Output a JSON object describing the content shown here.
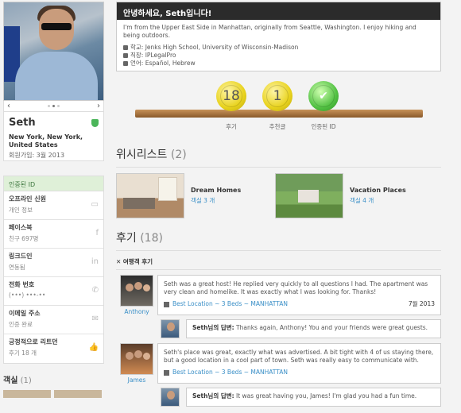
{
  "profile": {
    "name": "Seth",
    "location": "New York, New York, United States",
    "member_since": "회원가입: 3월 2013",
    "prev": "‹",
    "next": "›"
  },
  "verifications": {
    "header": "인증된 ID",
    "items": [
      {
        "title": "오프라인 신원",
        "sub": "개인 정보",
        "icon": "id-card-icon",
        "glyph": "▭"
      },
      {
        "title": "페이스북",
        "sub": "친구 697명",
        "icon": "facebook-icon",
        "glyph": "f"
      },
      {
        "title": "링크드인",
        "sub": "연동됨",
        "icon": "linkedin-icon",
        "glyph": "in"
      },
      {
        "title": "전화 번호",
        "sub": "(•••) •••-••",
        "icon": "phone-icon",
        "glyph": "✆"
      },
      {
        "title": "이메일 주소",
        "sub": "인증 완료",
        "icon": "mail-icon",
        "glyph": "✉"
      },
      {
        "title": "긍정적으로 리트던",
        "sub": "후기 18 개",
        "icon": "thumbs-up-icon",
        "glyph": "👍"
      }
    ]
  },
  "left_wishlist": {
    "title": "객실",
    "count": "(1)"
  },
  "greeting": {
    "title": "안녕하세요, Seth입니다!",
    "bio": "I'm from the Upper East Side in Manhattan, originally from Seattle, Washington. I enjoy hiking and being outdoors.",
    "school": "학교: Jenks High School, University of Wisconsin-Madison",
    "work": "직장: IPLegalPro",
    "languages": "언어: Español, Hebrew"
  },
  "badges": [
    {
      "value": "18",
      "label": "후기"
    },
    {
      "value": "1",
      "label": "추천글"
    },
    {
      "value": "✔",
      "label": "인증된 ID"
    }
  ],
  "wishlists": {
    "title": "위시리스트",
    "count": "(2)",
    "items": [
      {
        "name": "Dream Homes",
        "count": "객실 3 개"
      },
      {
        "name": "Vacation Places",
        "count": "객실 4 개"
      }
    ]
  },
  "reviews": {
    "title": "후기",
    "count": "(18)",
    "tab": "✕ 여행객 후기",
    "items": [
      {
        "author": "Anthony",
        "text": "Seth was a great host! He replied very quickly to all questions I had. The apartment was very clean and homelike. It was exactly what I was looking for. Thanks!",
        "listing": "Best Location ~ 3 Beds ~ MANHATTAN",
        "date": "7월 2013",
        "reply_label": "Seth님의 답변:",
        "reply": "Thanks again, Anthony! You and your friends were great guests."
      },
      {
        "author": "James",
        "text": "Seth's place was great, exactly what was advertised. A bit tight with 4 of us staying there, but a good location in a cool part of town. Seth was really easy to communicate with.",
        "listing": "Best Location ~ 3 Beds ~ MANHATTAN",
        "date": "",
        "reply_label": "Seth님의 답변:",
        "reply": "It was great having you, James! I'm glad you had a fun time."
      }
    ]
  }
}
